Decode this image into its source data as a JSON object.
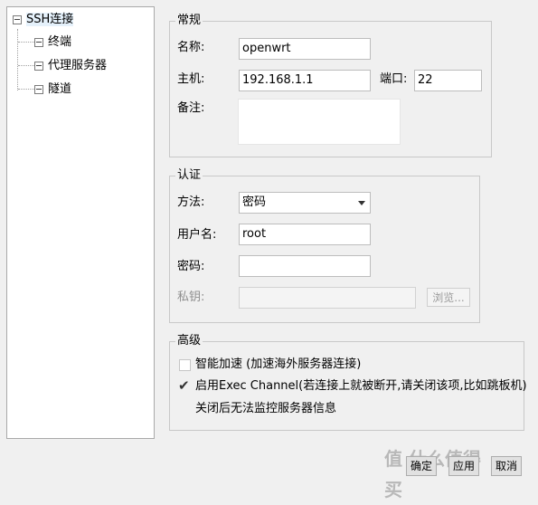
{
  "tree": {
    "root": "SSH连接",
    "children": [
      "终端",
      "代理服务器",
      "隧道"
    ]
  },
  "general": {
    "title": "常规",
    "name_label": "名称:",
    "name_value": "openwrt",
    "host_label": "主机:",
    "host_value": "192.168.1.1",
    "port_label": "端口:",
    "port_value": "22",
    "note_label": "备注:",
    "note_value": ""
  },
  "auth": {
    "title": "认证",
    "method_label": "方法:",
    "method_value": "密码",
    "user_label": "用户名:",
    "user_value": "root",
    "password_label": "密码:",
    "password_value": "",
    "key_label": "私钥:",
    "key_value": "",
    "browse_label": "浏览..."
  },
  "advanced": {
    "title": "高级",
    "smart_accel": "智能加速 (加速海外服务器连接)",
    "smart_accel_checked": false,
    "exec_channel": "启用Exec Channel(若连接上就被断开,请关闭该项,比如跳板机)",
    "exec_channel_checked": true,
    "exec_channel_note": "关闭后无法监控服务器信息"
  },
  "footer": {
    "ok_label": "确定",
    "apply_label": "应用",
    "cancel_label": "取消"
  },
  "watermark": "值 什么值得买"
}
